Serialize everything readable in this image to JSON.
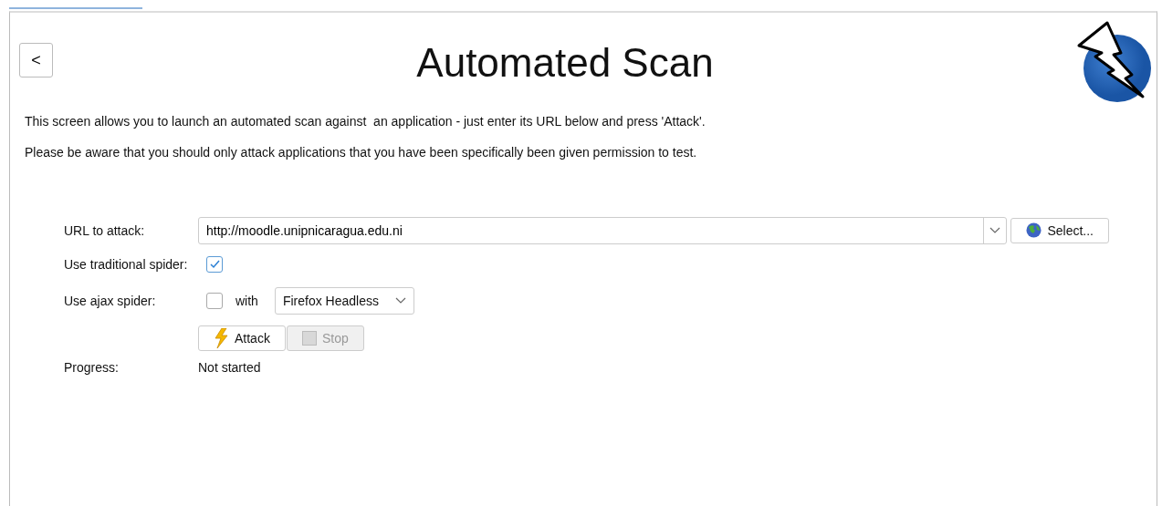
{
  "header": {
    "back_button": "<",
    "title": "Automated Scan"
  },
  "description": [
    "This screen allows you to launch an automated scan against  an application - just enter its URL below and press 'Attack'.",
    "Please be aware that you should only attack applications that you have been specifically been given permission to test."
  ],
  "form": {
    "url_label": "URL to attack:",
    "url_value": "http://moodle.unipnicaragua.edu.ni",
    "select_button": "Select...",
    "traditional_label": "Use traditional spider:",
    "traditional_checked": true,
    "ajax_label": "Use ajax spider:",
    "ajax_checked": false,
    "with_label": "with",
    "browser": "Firefox Headless",
    "attack_button": {
      "label": "Attack",
      "disabled": false
    },
    "stop_button": {
      "label": "Stop",
      "disabled": true
    },
    "progress_label": "Progress:",
    "progress_value": "Not started"
  }
}
